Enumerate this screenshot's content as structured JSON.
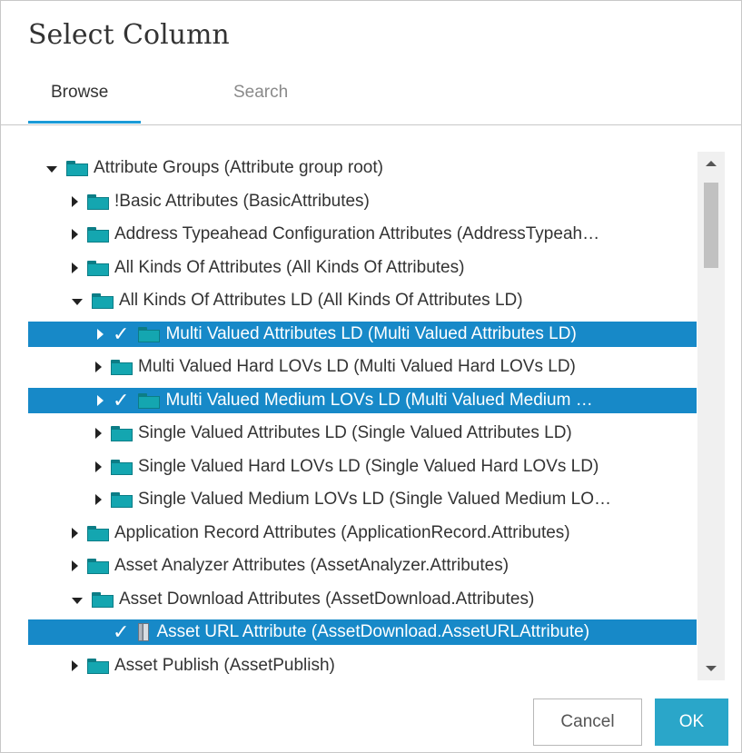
{
  "dialog": {
    "title": "Select Column",
    "tabs": [
      {
        "label": "Browse",
        "active": true
      },
      {
        "label": "Search",
        "active": false
      }
    ],
    "cancel_label": "Cancel",
    "ok_label": "OK",
    "accent_color": "#1789c8",
    "ok_color": "#2aa6c9"
  },
  "tree": {
    "rows": [
      {
        "label": "Attribute Groups (Attribute group root)",
        "depth": 0,
        "state": "expanded",
        "icon": "folder-icon",
        "selected": false
      },
      {
        "label": "!Basic Attributes (BasicAttributes)",
        "depth": 1,
        "state": "collapsed",
        "icon": "folder-icon",
        "selected": false
      },
      {
        "label": "Address Typeahead Configuration Attributes (AddressTypeah…",
        "depth": 1,
        "state": "collapsed",
        "icon": "folder-icon",
        "selected": false
      },
      {
        "label": "All Kinds Of Attributes (All Kinds Of Attributes)",
        "depth": 1,
        "state": "collapsed",
        "icon": "folder-icon",
        "selected": false
      },
      {
        "label": "All Kinds Of Attributes LD (All Kinds Of Attributes LD)",
        "depth": 1,
        "state": "expanded",
        "icon": "folder-icon",
        "selected": false
      },
      {
        "label": "Multi Valued Attributes LD (Multi Valued Attributes LD)",
        "depth": 2,
        "state": "collapsed",
        "icon": "folder-icon",
        "selected": true
      },
      {
        "label": "Multi Valued Hard LOVs LD (Multi Valued Hard LOVs LD)",
        "depth": 2,
        "state": "collapsed",
        "icon": "folder-icon",
        "selected": false
      },
      {
        "label": "Multi Valued Medium LOVs LD (Multi Valued Medium …",
        "depth": 2,
        "state": "collapsed",
        "icon": "folder-icon",
        "selected": true
      },
      {
        "label": "Single Valued Attributes LD (Single Valued Attributes LD)",
        "depth": 2,
        "state": "collapsed",
        "icon": "folder-icon",
        "selected": false
      },
      {
        "label": "Single Valued Hard LOVs LD (Single Valued Hard LOVs LD)",
        "depth": 2,
        "state": "collapsed",
        "icon": "folder-icon",
        "selected": false
      },
      {
        "label": "Single Valued Medium LOVs LD (Single Valued Medium LO…",
        "depth": 2,
        "state": "collapsed",
        "icon": "folder-icon",
        "selected": false
      },
      {
        "label": "Application Record Attributes (ApplicationRecord.Attributes)",
        "depth": 1,
        "state": "collapsed",
        "icon": "folder-icon",
        "selected": false
      },
      {
        "label": "Asset Analyzer Attributes (AssetAnalyzer.Attributes)",
        "depth": 1,
        "state": "collapsed",
        "icon": "folder-icon",
        "selected": false
      },
      {
        "label": "Asset Download Attributes (AssetDownload.Attributes)",
        "depth": 1,
        "state": "expanded",
        "icon": "folder-icon",
        "selected": false
      },
      {
        "label": "Asset URL Attribute (AssetDownload.AssetURLAttribute)",
        "depth": 2,
        "state": "leaf",
        "icon": "attribute-icon",
        "selected": true
      },
      {
        "label": "Asset Publish (AssetPublish)",
        "depth": 1,
        "state": "collapsed",
        "icon": "folder-icon",
        "selected": false
      }
    ]
  }
}
